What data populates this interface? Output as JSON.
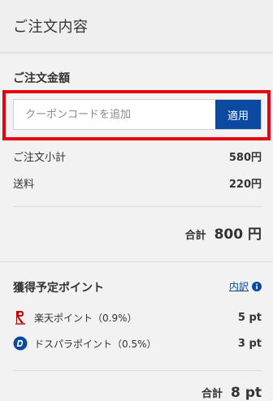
{
  "header": {
    "title": "ご注文内容"
  },
  "order_amount": {
    "title": "ご注文金額",
    "coupon": {
      "placeholder": "クーポンコードを追加",
      "value": "",
      "apply_label": "適用"
    },
    "subtotal": {
      "label": "ご注文小計",
      "value": "580円"
    },
    "shipping": {
      "label": "送料",
      "value": "220円"
    },
    "total": {
      "label": "合計",
      "value": "800 円"
    }
  },
  "points": {
    "title": "獲得予定ポイント",
    "breakdown_link": "内訳",
    "rakuten": {
      "label": "楽天ポイント（0.9%）",
      "value": "5 pt"
    },
    "dospara": {
      "label": "ドスパラポイント（0.5%）",
      "value": "3 pt"
    },
    "total": {
      "label": "合計",
      "value": "8 pt"
    }
  },
  "colors": {
    "highlight": "#e60012",
    "button": "#0b4aa0",
    "link": "#0b4aa0"
  },
  "icons": {
    "rakuten": "rakuten-r-icon",
    "dospara": "dospara-d-icon",
    "info": "info-icon"
  }
}
